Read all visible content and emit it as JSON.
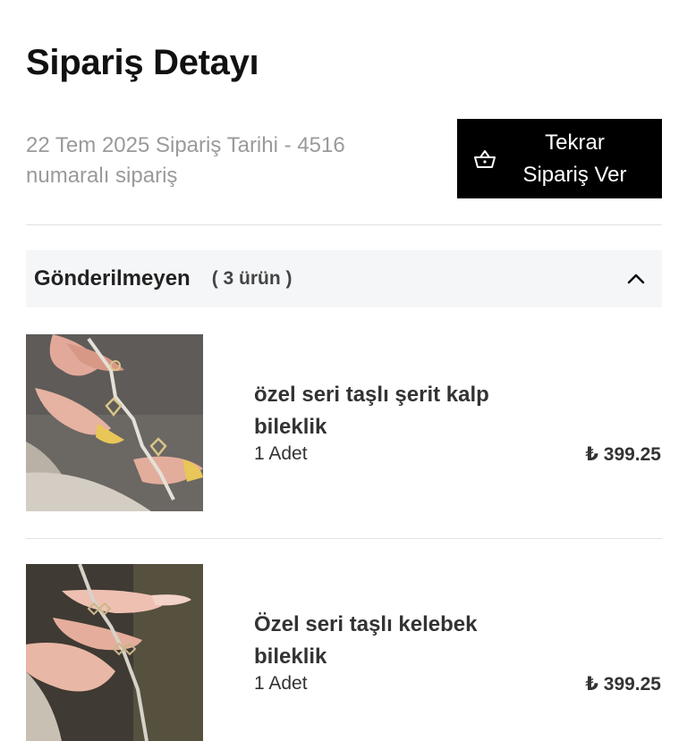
{
  "header": {
    "title": "Sipariş Detayı",
    "order_meta_line1": "22 Tem 2025 Sipariş Tarihi - 4516",
    "order_meta_line2": "numaralı sipariş",
    "reorder_line1": "Tekrar",
    "reorder_line2": "Sipariş Ver",
    "reorder_icon": "basket-icon"
  },
  "section": {
    "title": "Gönderilmeyen",
    "count": "( 3 ürün )",
    "toggle_icon": "chevron-up-icon"
  },
  "items": [
    {
      "name_line1": "özel seri taşlı şerit kalp",
      "name_line2": "bileklik",
      "qty": "1 Adet",
      "price": "₺ 399.25"
    },
    {
      "name_line1": "Özel seri taşlı kelebek",
      "name_line2": "bileklik",
      "qty": "1 Adet",
      "price": "₺ 399.25"
    }
  ],
  "colors": {
    "primary_button": "#000000",
    "muted_text": "#9a9a9a",
    "section_bg": "#f5f6f8"
  }
}
